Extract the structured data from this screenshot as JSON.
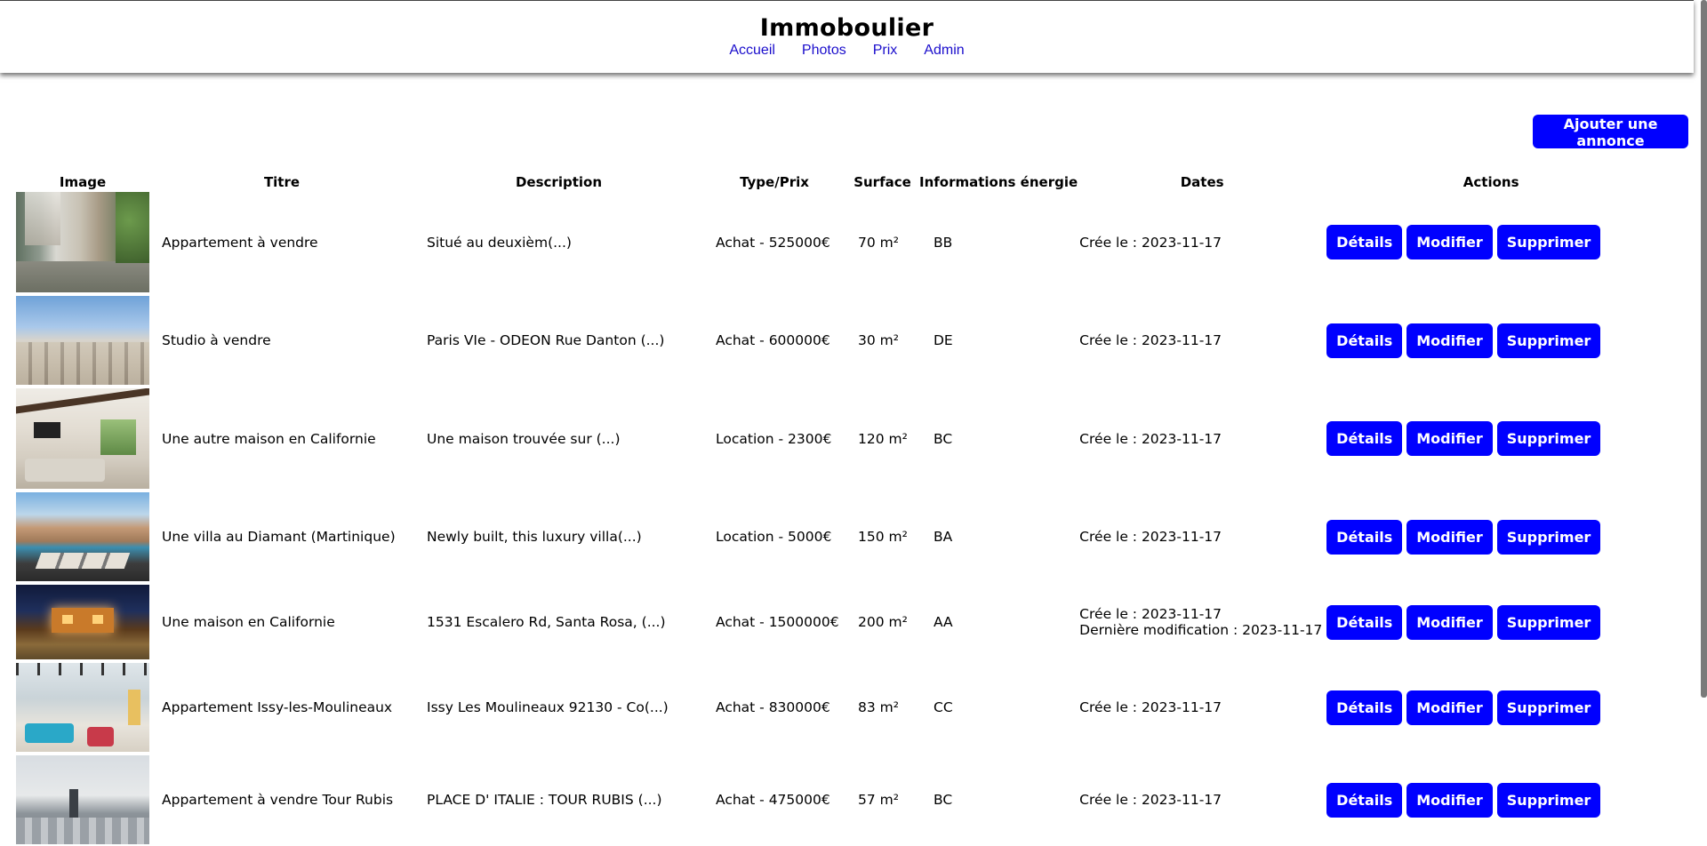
{
  "site": {
    "title": "Immoboulier",
    "nav": [
      "Accueil",
      "Photos",
      "Prix",
      "Admin"
    ]
  },
  "add_button": "Ajouter une annonce",
  "table": {
    "headers": [
      "Image",
      "Titre",
      "Description",
      "Type/Prix",
      "Surface",
      "Informations énergie",
      "Dates",
      "Actions"
    ],
    "action_labels": [
      "Détails",
      "Modifier",
      "Supprimer"
    ],
    "rows": [
      {
        "title": "Appartement à vendre",
        "description": "Situé au deuxièm(...)",
        "type_price": "Achat - 525000€",
        "surface": "70 m²",
        "energy": "BB",
        "created": "Crée le : 2023-11-17",
        "modified": ""
      },
      {
        "title": "Studio à vendre",
        "description": "Paris VIe - ODEON Rue Danton (...)",
        "type_price": "Achat - 600000€",
        "surface": "30 m²",
        "energy": "DE",
        "created": "Crée le : 2023-11-17",
        "modified": ""
      },
      {
        "title": "Une autre maison en Californie",
        "description": "Une maison trouvée sur (...)",
        "type_price": "Location - 2300€",
        "surface": "120 m²",
        "energy": "BC",
        "created": "Crée le : 2023-11-17",
        "modified": ""
      },
      {
        "title": "Une villa au Diamant (Martinique)",
        "description": "Newly built, this luxury villa(...)",
        "type_price": "Location - 5000€",
        "surface": "150 m²",
        "energy": "BA",
        "created": "Crée le : 2023-11-17",
        "modified": ""
      },
      {
        "title": "Une maison en Californie",
        "description": "1531 Escalero Rd, Santa Rosa, (...)",
        "type_price": "Achat - 1500000€",
        "surface": "200 m²",
        "energy": "AA",
        "created": "Crée le : 2023-11-17",
        "modified": "Dernière modification : 2023-11-17"
      },
      {
        "title": "Appartement Issy-les-Moulineaux",
        "description": "Issy Les Moulineaux 92130 - Co(...)",
        "type_price": "Achat - 830000€",
        "surface": "83 m²",
        "energy": "CC",
        "created": "Crée le : 2023-11-17",
        "modified": ""
      },
      {
        "title": "Appartement à vendre Tour Rubis",
        "description": "PLACE D' ITALIE : TOUR RUBIS (...)",
        "type_price": "Achat - 475000€",
        "surface": "57 m²",
        "energy": "BC",
        "created": "Crée le : 2023-11-17",
        "modified": ""
      }
    ]
  },
  "colors": {
    "accent": "#0000ff",
    "nav_link": "#1a0dcc"
  }
}
